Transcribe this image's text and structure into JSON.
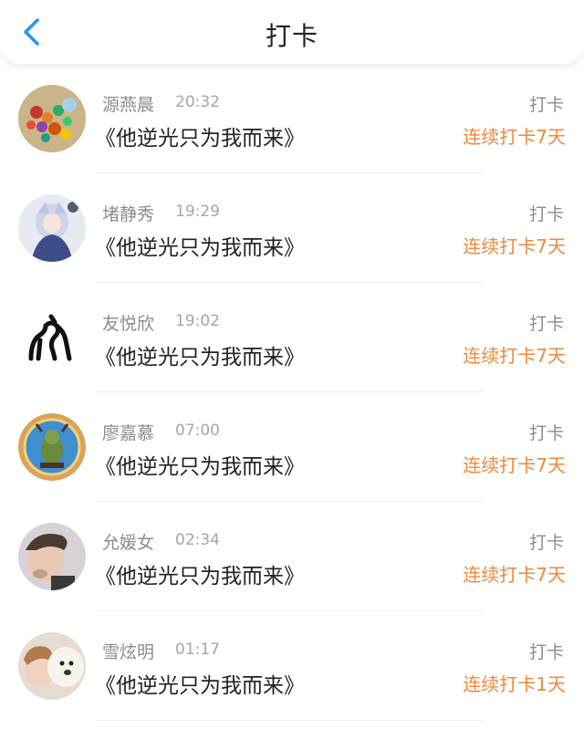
{
  "header": {
    "title": "打卡",
    "back_icon": "back-chevron-icon"
  },
  "colors": {
    "accent_blue": "#2196f3",
    "streak_orange": "#f0883a",
    "meta_gray": "#8c8c8c"
  },
  "checkins": [
    {
      "name": "源燕晨",
      "time": "20:32",
      "book": "《他逆光只为我而来》",
      "type": "打卡",
      "streak": "连续打卡7天"
    },
    {
      "name": "堵静秀",
      "time": "19:29",
      "book": "《他逆光只为我而来》",
      "type": "打卡",
      "streak": "连续打卡7天"
    },
    {
      "name": "友悦欣",
      "time": "19:02",
      "book": "《他逆光只为我而来》",
      "type": "打卡",
      "streak": "连续打卡7天"
    },
    {
      "name": "廖嘉慕",
      "time": "07:00",
      "book": "《他逆光只为我而来》",
      "type": "打卡",
      "streak": "连续打卡7天"
    },
    {
      "name": "允媛女",
      "time": "02:34",
      "book": "《他逆光只为我而来》",
      "type": "打卡",
      "streak": "连续打卡7天"
    },
    {
      "name": "雪炫明",
      "time": "01:17",
      "book": "《他逆光只为我而来》",
      "type": "打卡",
      "streak": "连续打卡1天"
    }
  ]
}
